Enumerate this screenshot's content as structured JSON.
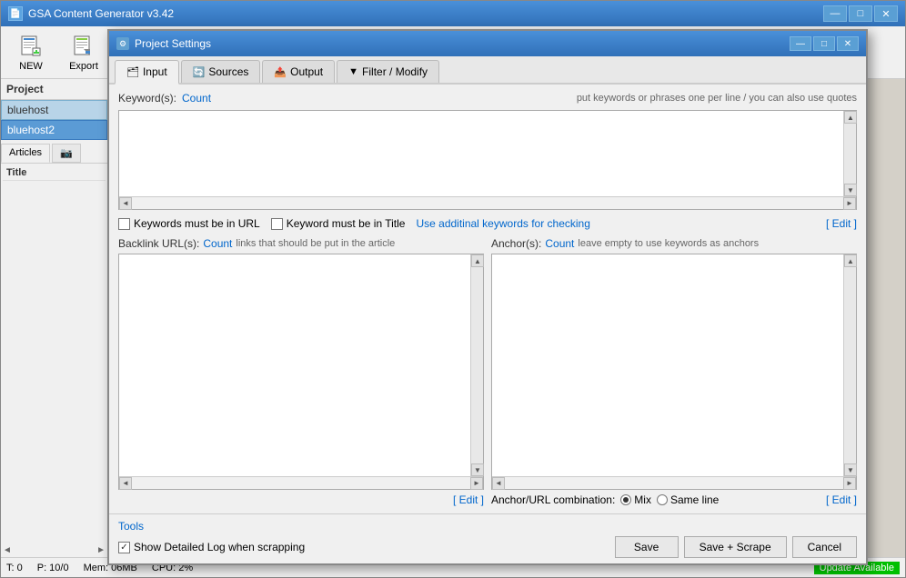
{
  "app": {
    "title": "GSA Content Generator v3.42",
    "icon": "📄"
  },
  "toolbar": {
    "new_label": "NEW",
    "export_label": "Export"
  },
  "sidebar": {
    "section_title": "Project",
    "items": [
      "bluehost",
      "bluehost2"
    ],
    "tabs": [
      "Articles",
      "📷"
    ],
    "col_header": "Title",
    "scroll_left": "◄",
    "scroll_right": "►"
  },
  "status_bar": {
    "t_label": "T: 0",
    "p_label": "P: 10/0",
    "mem_label": "Mem: 06MB",
    "cpu_label": "CPU: 2%",
    "update_label": "Update Available"
  },
  "dialog": {
    "title": "Project Settings",
    "icon": "⚙",
    "tabs": [
      {
        "label": "Input",
        "icon": "🗂"
      },
      {
        "label": "Sources",
        "icon": "🔄"
      },
      {
        "label": "Output",
        "icon": "📤"
      },
      {
        "label": "Filter / Modify",
        "icon": "▼"
      }
    ],
    "keywords_label": "Keyword(s):",
    "keywords_count": "Count",
    "keywords_hint": "put keywords or phrases one per line / you can also use quotes",
    "keywords_must_be_in_url_label": "Keywords must be in URL",
    "keyword_must_be_in_title_label": "Keyword must be in Title",
    "use_additional_keywords_label": "Use additinal keywords for checking",
    "edit_label": "[ Edit ]",
    "backlink_label": "Backlink URL(s):",
    "backlink_count": "Count",
    "backlink_hint": "links that should be put in the article",
    "backlink_edit": "[ Edit ]",
    "anchor_label": "Anchor(s):",
    "anchor_count": "Count",
    "anchor_hint": "leave empty to use keywords as anchors",
    "anchor_combo_label": "Anchor/URL combination:",
    "anchor_mix": "Mix",
    "anchor_same_line": "Same line",
    "anchor_edit": "[ Edit ]",
    "footer": {
      "tools_label": "Tools",
      "show_log_label": "Show Detailed Log when scrapping",
      "save_label": "Save",
      "save_scrape_label": "Save + Scrape",
      "cancel_label": "Cancel"
    }
  },
  "controls": {
    "minimize": "—",
    "maximize": "□",
    "close": "✕"
  }
}
